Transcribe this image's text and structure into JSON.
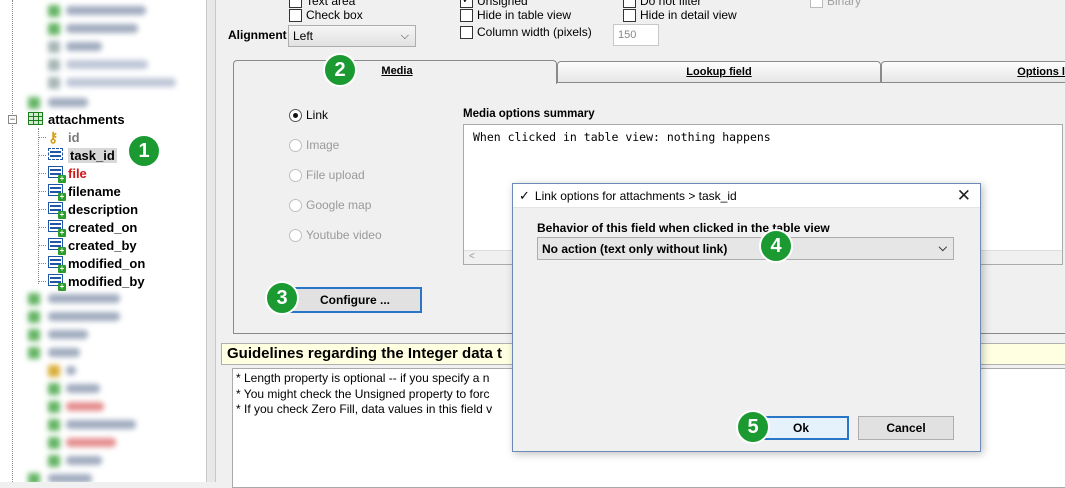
{
  "badges": {
    "b1": "1",
    "b2": "2",
    "b3": "3",
    "b4": "4",
    "b5": "5"
  },
  "tree": {
    "table_name": "attachments",
    "fields": [
      {
        "name": "id",
        "style": "key"
      },
      {
        "name": "task_id",
        "style": "selected"
      },
      {
        "name": "file",
        "style": "red"
      },
      {
        "name": "filename",
        "style": "normal"
      },
      {
        "name": "description",
        "style": "normal"
      },
      {
        "name": "created_on",
        "style": "normal"
      },
      {
        "name": "created_by",
        "style": "normal"
      },
      {
        "name": "modified_on",
        "style": "normal"
      },
      {
        "name": "modified_by",
        "style": "normal"
      }
    ]
  },
  "options": {
    "text_area": "Text area",
    "check_box": "Check box",
    "unsigned": "Unsigned",
    "hide_in_table_view": "Hide in table view",
    "column_width": "Column width (pixels)",
    "column_width_value": "150",
    "do_not_filter": "Do not filter",
    "hide_in_detail_view": "Hide in detail view",
    "binary": "Binary",
    "alignment_label": "Alignment",
    "alignment_value": "Left"
  },
  "tabs": {
    "media": "Media",
    "lookup": "Lookup field",
    "options": "Options li"
  },
  "media": {
    "link": "Link",
    "image": "Image",
    "file_upload": "File upload",
    "google_map": "Google map",
    "youtube": "Youtube video",
    "summary_label": "Media options summary",
    "summary_text": "When clicked in table view: nothing happens",
    "configure_button": "Configure ..."
  },
  "guidelines": {
    "title": "Guidelines regarding the Integer data t",
    "lines": [
      "* Length property is optional -- if you specify a n",
      "* You might check the Unsigned property to forc",
      "* If you check Zero Fill, data values in this field v"
    ]
  },
  "dialog": {
    "title": "Link options for attachments > task_id",
    "behavior_label": "Behavior of this field when clicked in the table view",
    "behavior_value": "No action (text only without link)",
    "ok": "Ok",
    "cancel": "Cancel"
  }
}
